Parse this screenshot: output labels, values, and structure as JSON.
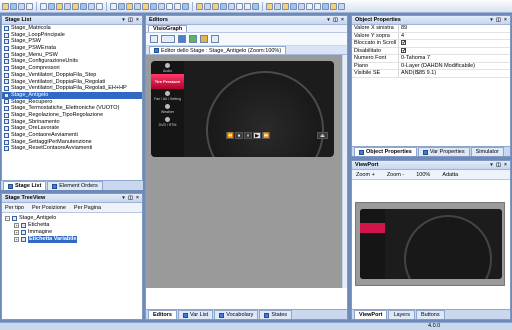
{
  "toolbar": {
    "icon_count": 40
  },
  "stage_list": {
    "title": "Stage List",
    "items": [
      "Stage_Matricola",
      "Stage_LoopPrincipale",
      "Stage_PSW",
      "Stage_PSWErrata",
      "Stage_Menu_PSW",
      "Stage_ConfigurazioneUnits",
      "Stage_Compressori",
      "Stage_Ventilatori_DoppiaFila_Step",
      "Stage_Ventilatori_DoppiaFila_Regolati",
      "Stage_Ventilatori_DoppiaFila_Regolati_EH+HP",
      "Stage_Antigelo",
      "Stage_Recupero",
      "Stage_Termostatiche_Elettroniche (VUOTO)",
      "Stage_Regolazione_TipoRegolazione",
      "Stage_Sbrinamento",
      "Stage_OreLavorate",
      "Stage_ContaoreAvviamenti",
      "Stage_SettaggiPerManutenzione",
      "Stage_ResetContaoreAvviamenti"
    ],
    "selected_index": 10,
    "tabs": [
      "Stage List",
      "Element Orders"
    ]
  },
  "stage_treeview": {
    "title": "Stage TreeView",
    "filters": [
      "Per tipo",
      "Per Posizione",
      "Per Pagina"
    ],
    "root": "Stage_Antigelo",
    "children": [
      "Etichetta",
      "Immagine",
      "Etichetta Variabile"
    ]
  },
  "editors": {
    "title": "Editors",
    "inner_tab": "VisioGraph",
    "doc_tab": "Editor dello Stage : Stage_Antigelo (Zoom:100%)",
    "device_menu": [
      "Audio",
      "Tire Pressure",
      "Fan / Air / Setting",
      "Weather",
      "DVD / RTM"
    ],
    "player_buttons": [
      "⏪",
      "⏹",
      "⏸",
      "▶",
      "⏩"
    ],
    "bottom_tabs": [
      "Editors",
      "Var List",
      "Vocabolary",
      "States"
    ]
  },
  "object_properties": {
    "title": "Object Properties",
    "rows": [
      {
        "key": "Valore X sinistra",
        "value": "89"
      },
      {
        "key": "Valore Y sopra",
        "value": "4"
      },
      {
        "key": "Bloccato in Scroll",
        "value": "✔"
      },
      {
        "key": "Disabilitato",
        "value": "✔"
      },
      {
        "key": "Numero Font",
        "value": "0-Tahoma 7"
      },
      {
        "key": "Piano",
        "value": "0-Layer (DAHDN Modificabile)"
      },
      {
        "key": "Visibile SE",
        "value": "AND(I$85 9.1)"
      }
    ],
    "tabs": [
      "Object Properties",
      "Var Properties",
      "Simulator"
    ]
  },
  "viewport": {
    "title": "ViewPort",
    "zoom_in": "Zoom +",
    "zoom_out": "Zoom -",
    "zoom_level": "100%",
    "fit": "Adatta",
    "tabs": [
      "ViewPort",
      "Layers",
      "Buttons"
    ]
  },
  "status": {
    "version": "4.0.0"
  }
}
